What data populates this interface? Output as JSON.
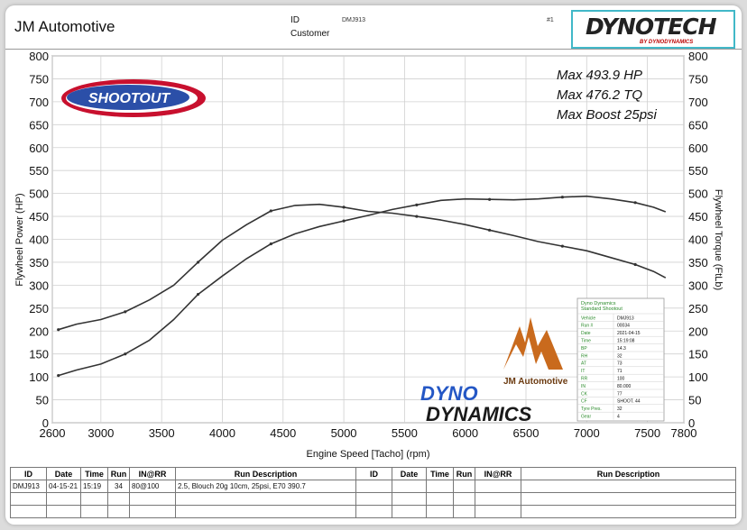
{
  "header": {
    "company": "JM Automotive",
    "id_label": "ID",
    "id_value": "DMJ913",
    "customer_label": "Customer",
    "page_no": "#1"
  },
  "brand": {
    "dynotech_word": "DYNOTECH",
    "dynotech_sub": "BY DYNODYNAMICS",
    "shootout_word": "SHOOTOUT",
    "jm_logo_text": "JM Automotive",
    "dd_line1": "DYNO",
    "dd_line2": "DYNAMICS"
  },
  "chart_data": {
    "type": "line",
    "xlabel": "Engine Speed [Tacho] (rpm)",
    "ylabel_left": "Flywheel Power (HP)",
    "ylabel_right": "Flywheel Torque (FtLb)",
    "xlim": [
      2600,
      7800
    ],
    "xticks": [
      2600,
      3000,
      3500,
      4000,
      4500,
      5000,
      5500,
      6000,
      6500,
      7000,
      7500,
      7800
    ],
    "ylim": [
      0,
      800
    ],
    "yticks": [
      0,
      50,
      100,
      150,
      200,
      250,
      300,
      350,
      400,
      450,
      500,
      550,
      600,
      650,
      700,
      750,
      800
    ],
    "grid": true,
    "annotations": [
      "Max 493.9 HP",
      "Max 476.2 TQ",
      "Max Boost 25psi"
    ],
    "series": [
      {
        "id": "power",
        "color": "#333333",
        "points": [
          [
            2650,
            103
          ],
          [
            2800,
            115
          ],
          [
            3000,
            128
          ],
          [
            3200,
            150
          ],
          [
            3400,
            180
          ],
          [
            3600,
            225
          ],
          [
            3800,
            280
          ],
          [
            4000,
            320
          ],
          [
            4200,
            358
          ],
          [
            4400,
            390
          ],
          [
            4600,
            412
          ],
          [
            4800,
            428
          ],
          [
            5000,
            440
          ],
          [
            5200,
            452
          ],
          [
            5400,
            465
          ],
          [
            5600,
            475
          ],
          [
            5800,
            485
          ],
          [
            6000,
            488
          ],
          [
            6200,
            487
          ],
          [
            6400,
            486
          ],
          [
            6600,
            488
          ],
          [
            6800,
            492
          ],
          [
            7000,
            493.9
          ],
          [
            7200,
            488
          ],
          [
            7400,
            480
          ],
          [
            7550,
            470
          ],
          [
            7650,
            460
          ]
        ]
      },
      {
        "id": "torque",
        "color": "#333333",
        "points": [
          [
            2650,
            203
          ],
          [
            2800,
            215
          ],
          [
            3000,
            225
          ],
          [
            3200,
            242
          ],
          [
            3400,
            268
          ],
          [
            3600,
            300
          ],
          [
            3800,
            350
          ],
          [
            4000,
            398
          ],
          [
            4200,
            432
          ],
          [
            4400,
            462
          ],
          [
            4600,
            474
          ],
          [
            4800,
            476.2
          ],
          [
            5000,
            470
          ],
          [
            5200,
            461
          ],
          [
            5400,
            457
          ],
          [
            5600,
            450
          ],
          [
            5800,
            442
          ],
          [
            6000,
            432
          ],
          [
            6200,
            420
          ],
          [
            6400,
            408
          ],
          [
            6600,
            395
          ],
          [
            6800,
            385
          ],
          [
            7000,
            375
          ],
          [
            7200,
            360
          ],
          [
            7400,
            345
          ],
          [
            7550,
            330
          ],
          [
            7650,
            316
          ]
        ]
      }
    ]
  },
  "conditions": {
    "title1": "Dyno Dynamics",
    "title2": "Standard Shootout",
    "rows": [
      [
        "Vehicle",
        "DMJ913"
      ],
      [
        "Run #",
        "00034"
      ],
      [
        "Date",
        "2021-04-15"
      ],
      [
        "Time",
        "15:19:08"
      ],
      [
        "BP",
        "14.3"
      ],
      [
        "RH",
        "32"
      ],
      [
        "AT",
        "73"
      ],
      [
        "IT",
        "71"
      ],
      [
        "RR",
        "100"
      ],
      [
        "IN",
        "80.000"
      ],
      [
        "CK",
        "77"
      ],
      [
        "CF",
        "SHOOT. 44"
      ],
      [
        "Tyre Pres.",
        "32"
      ],
      [
        "Gear",
        "4"
      ]
    ]
  },
  "table": {
    "headers": [
      "ID",
      "Date",
      "Time",
      "Run",
      "IN@RR",
      "Run Description",
      "ID",
      "Date",
      "Time",
      "Run",
      "IN@RR",
      "Run Description"
    ],
    "rows": [
      [
        "DMJ913",
        "04-15-21",
        "15:19",
        "34",
        "80@100",
        "2.5, Blouch 20g 10cm, 25psi, E70 390.7",
        "",
        "",
        "",
        "",
        "",
        ""
      ],
      [
        "",
        "",
        "",
        "",
        "",
        "",
        "",
        "",
        "",
        "",
        "",
        ""
      ],
      [
        "",
        "",
        "",
        "",
        "",
        "",
        "",
        "",
        "",
        "",
        "",
        ""
      ]
    ]
  }
}
